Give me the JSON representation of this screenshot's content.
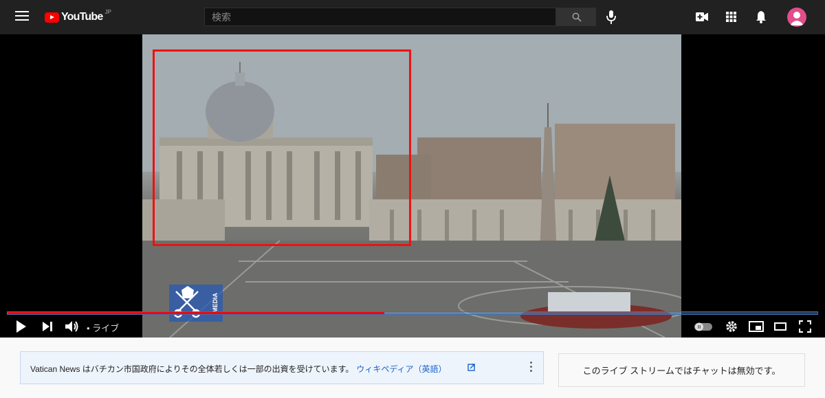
{
  "masthead": {
    "logo_text": "YouTube",
    "logo_region": "JP",
    "search_placeholder": "検索"
  },
  "player": {
    "watermark_text": "MEDIA",
    "live_label": "• ライブ",
    "progress_fraction": 0.465
  },
  "info_panel": {
    "text": "Vatican News はバチカン市国政府によりその全体若しくは一部の出資を受けています。",
    "link_text": "ウィキペディア（英語）"
  },
  "chat_panel": {
    "message": "このライブ ストリームではチャットは無効です。"
  },
  "colors": {
    "accent": "#ff0000",
    "avatar": "#e24d8b",
    "link": "#1a62c8"
  }
}
